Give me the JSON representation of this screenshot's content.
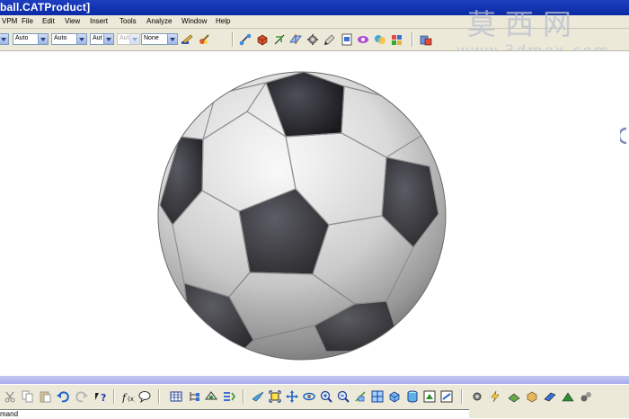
{
  "window": {
    "title": "ball.CATProduct]"
  },
  "menu": {
    "items": [
      "VPM",
      "File",
      "Edit",
      "View",
      "Insert",
      "Tools",
      "Analyze",
      "Window",
      "Help"
    ]
  },
  "toolbar_top": {
    "combos": [
      {
        "value": "Auto",
        "enabled": true
      },
      {
        "value": "Auto",
        "enabled": true
      },
      {
        "value": "Aut",
        "enabled": true
      },
      {
        "value": "Aut",
        "enabled": false
      },
      {
        "value": "None",
        "enabled": true
      }
    ]
  },
  "watermark": {
    "chinese": "莫西网",
    "url": "www.3dmox.com"
  },
  "command_bar": {
    "text": "mand"
  },
  "viewport": {
    "object": "soccer-ball",
    "background": "#ffffff"
  },
  "colors": {
    "title_bar": "#0a2aa6",
    "chrome": "#ece9d8",
    "status_band": "#a8acee"
  }
}
